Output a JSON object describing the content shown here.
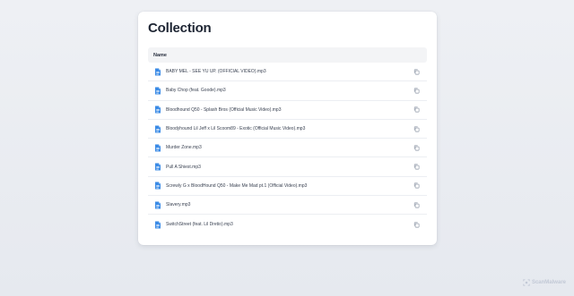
{
  "page": {
    "title": "Collection",
    "watermark": "ScanMalware"
  },
  "table": {
    "header": "Name",
    "files": [
      "BABY MEL - SEE YU UP. (OFFICIAL VIDEO).mp3",
      "Baby Chop (feat. Goode).mp3",
      "Bloodhound Q50 - Splash Bros (Official Music Video).mp3",
      "Bloodyhound Lil Jeff x Lil Scoom89 - Exotic (Official Music Video).mp3",
      "Murder Zone.mp3",
      "Pull A Shiest.mp3",
      "Screwly G x BloodHound Q50 - Make Me Mad pt.1 (Official Video).mp3",
      "Slavery.mp3",
      "SwitchStreet (feat. Lil Dretio).mp3"
    ]
  },
  "icons": {
    "file": "file-document-icon",
    "copy": "copy-icon",
    "watermark": "scan-logo-icon"
  },
  "colors": {
    "file_icon": "#3b8be6",
    "copy_icon": "#8a93a3",
    "title": "#1e2533",
    "header_bg": "#f3f4f6"
  }
}
